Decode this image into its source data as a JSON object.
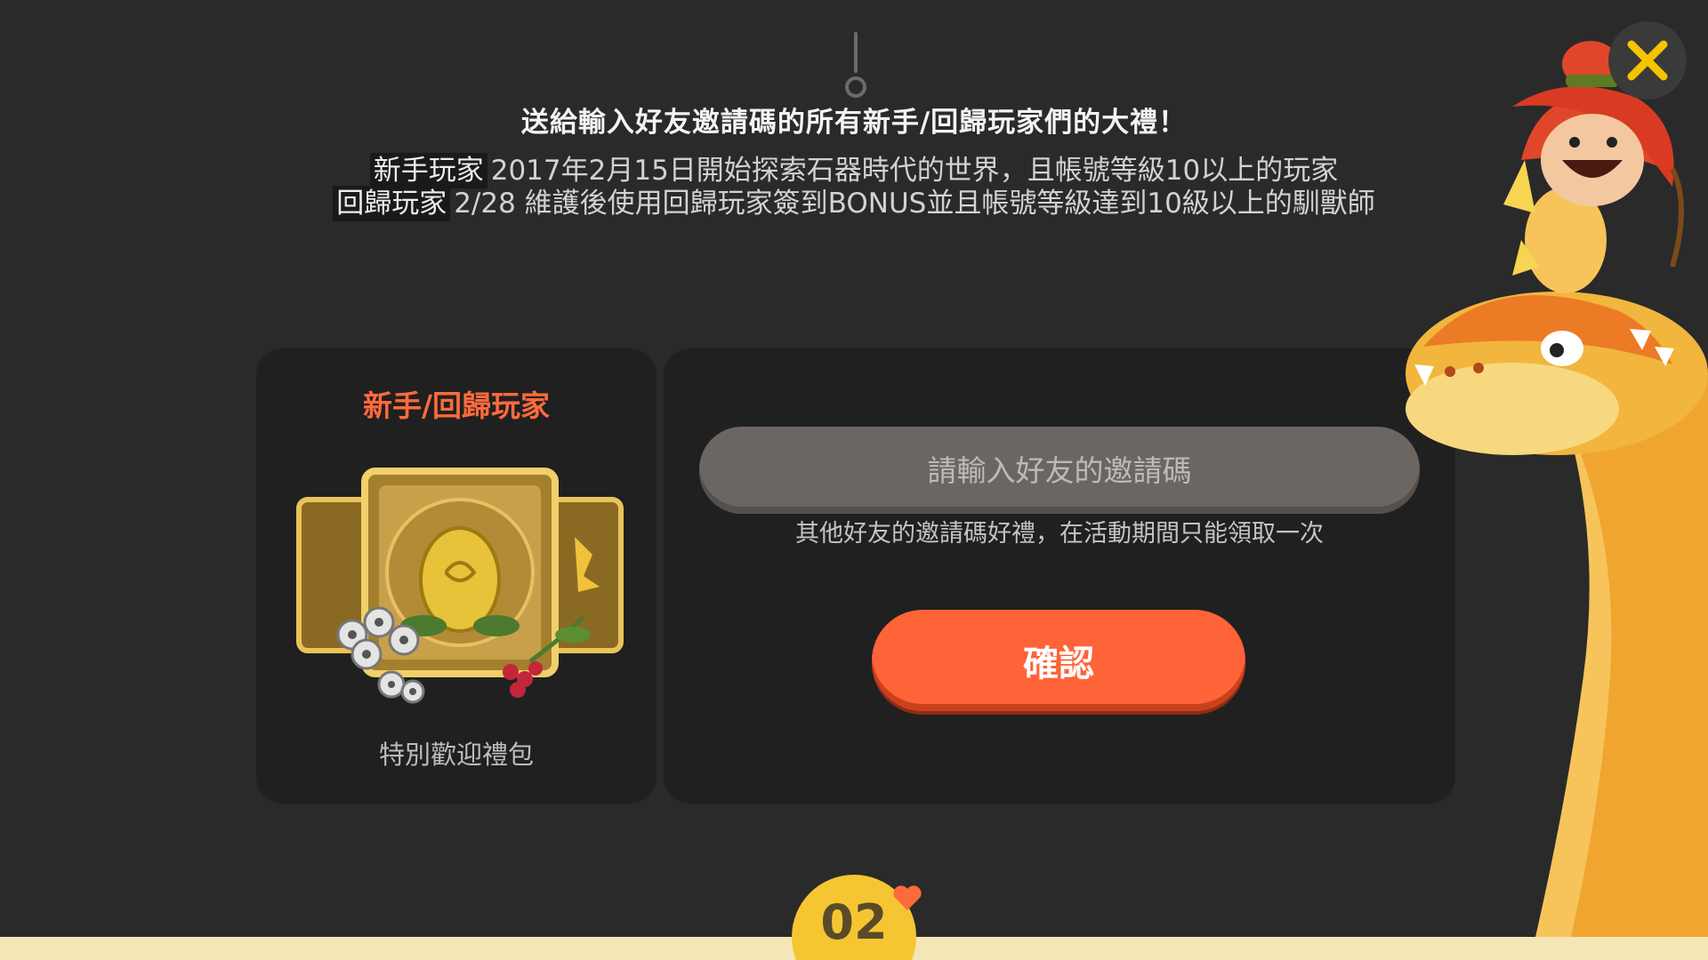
{
  "dialog": {
    "headline": "送給輸入好友邀請碼的所有新手/回歸玩家們的大禮！",
    "requirements": [
      {
        "tag": "新手玩家",
        "text": "2017年2月15日開始探索石器時代的世界，且帳號等級10以上的玩家"
      },
      {
        "tag": "回歸玩家",
        "text": "2/28 維護後使用回歸玩家簽到BONUS並且帳號等級達到10級以上的馴獸師"
      }
    ]
  },
  "reward": {
    "title": "新手/回歸玩家",
    "name": "特別歡迎禮包",
    "icon": "gift-pack-icon"
  },
  "invite": {
    "placeholder": "請輸入好友的邀請碼",
    "value": "",
    "note": "其他好友的邀請碼好禮，在活動期間只能領取一次",
    "confirm_label": "確認"
  },
  "pager": {
    "current": "02"
  },
  "colors": {
    "accent": "#ff6338",
    "title_accent": "#ff6a3d",
    "panel": "#202020",
    "background": "#2a2a2a",
    "close_x": "#f5c400",
    "badge": "#f5c631"
  },
  "icons": {
    "close": "close-icon",
    "mascot": "caveman-dinosaur-mascot",
    "heart": "heart-icon"
  }
}
